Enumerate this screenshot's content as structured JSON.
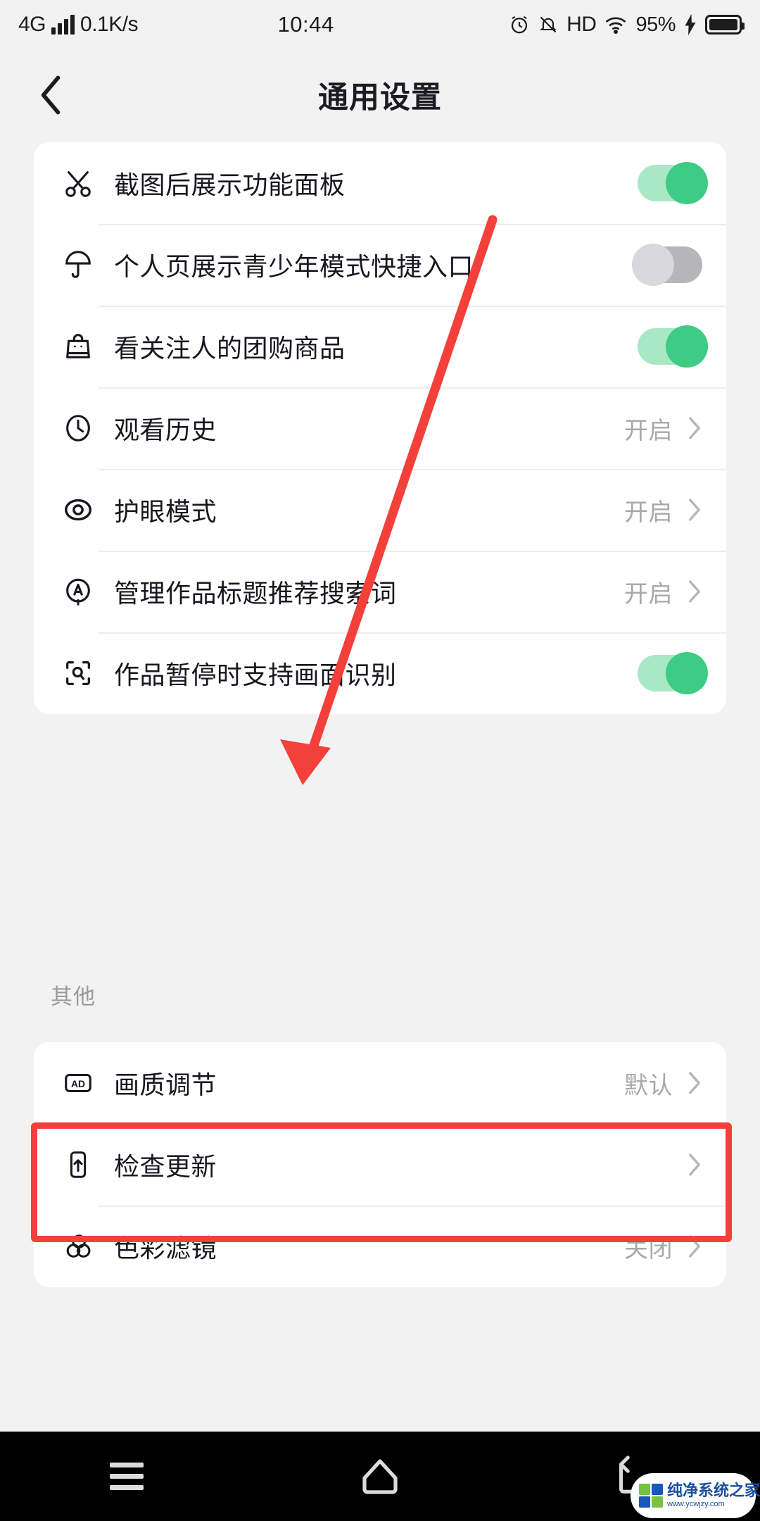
{
  "status_bar": {
    "network": "4G",
    "speed": "0.1K/s",
    "time": "10:44",
    "battery_percent": "95%",
    "icons": [
      "signal-bars-icon",
      "alarm-icon",
      "mute-icon",
      "hd-icon",
      "wifi-icon",
      "charging-bolt-icon",
      "battery-icon"
    ]
  },
  "header": {
    "back_label": "返回",
    "title": "通用设置"
  },
  "sections": [
    {
      "id": "general",
      "header": "",
      "rows": [
        {
          "label": "截图后展示功能面板",
          "icon": "scissors-icon",
          "control": "toggle",
          "state": "on"
        },
        {
          "label": "个人页展示青少年模式快捷入口",
          "icon": "umbrella-icon",
          "control": "toggle",
          "state": "off"
        },
        {
          "label": "看关注人的团购商品",
          "icon": "shopping-bag-icon",
          "control": "toggle",
          "state": "on"
        },
        {
          "label": "观看历史",
          "icon": "clock-icon",
          "control": "value",
          "value": "开启"
        },
        {
          "label": "护眼模式",
          "icon": "eye-icon",
          "control": "value",
          "value": "开启"
        },
        {
          "label": "管理作品标题推荐搜索词",
          "icon": "circle-a-icon",
          "control": "value",
          "value": "开启"
        },
        {
          "label": "作品暂停时支持画面识别",
          "icon": "scan-search-icon",
          "control": "toggle",
          "state": "on"
        }
      ]
    },
    {
      "id": "other",
      "header": "其他",
      "rows": [
        {
          "label": "画质调节",
          "icon": "ad-badge-icon",
          "control": "value",
          "value": "默认"
        },
        {
          "label": "检查更新",
          "icon": "phone-update-icon",
          "control": "value",
          "value": ""
        },
        {
          "label": "色彩滤镜",
          "icon": "color-filter-icon",
          "control": "value",
          "value": "关闭"
        }
      ]
    }
  ],
  "annotation": {
    "arrow_color": "#f4403a",
    "highlight_color": "#f4403a",
    "highlight_target": "检查更新",
    "arrow_from": "个人页展示青少年模式快捷入口",
    "arrow_to": "画质调节"
  },
  "nav_bar": {
    "items": [
      "menu-icon",
      "home-icon",
      "back-icon"
    ]
  },
  "watermark": {
    "title": "纯净系统之家",
    "url": "www.ycwjzy.com"
  },
  "colors": {
    "toggle_on_track": "#a8e8c4",
    "toggle_on_thumb": "#3ecb83",
    "toggle_off_track": "#b6b6ba",
    "toggle_off_thumb": "#d8d8da",
    "page_bg": "#f2f2f2",
    "card_bg": "#ffffff",
    "text_primary": "#17171f",
    "text_secondary": "#a8a8ad"
  }
}
